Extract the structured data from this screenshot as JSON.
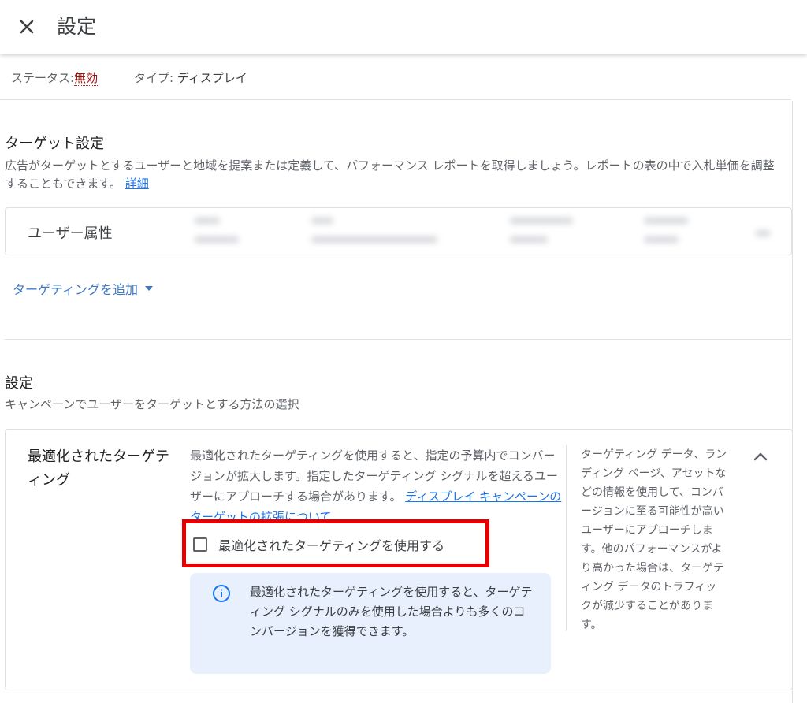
{
  "header": {
    "title": "設定",
    "close_icon": "close-icon"
  },
  "status_bar": {
    "status_label": "ステータス:",
    "status_value": "無効",
    "type_label": "タイプ:",
    "type_value": "ディスプレイ"
  },
  "targeting_section": {
    "title": "ターゲット設定",
    "description": "広告がターゲットとするユーザーと地域を提案または定義して、パフォーマンス レポートを取得しましょう。レポートの表の中で入札単価を調整することもできます。",
    "details_link": "詳細",
    "demographics_label": "ユーザー属性",
    "add_targeting_label": "ターゲティングを追加",
    "dropdown_icon": "caret-down-icon"
  },
  "settings_section": {
    "title": "設定",
    "description": "キャンペーンでユーザーをターゲットとする方法の選択"
  },
  "optimized_targeting": {
    "title": "最適化されたターゲティング",
    "description": "最適化されたターゲティングを使用すると、指定の予算内でコンバージョンが拡大します。指定したターゲティング シグナルを超えるユーザーにアプローチする場合があります。",
    "link": "ディスプレイ キャンペーンのターゲットの拡張について",
    "checkbox_label": "最適化されたターゲティングを使用する",
    "checkbox_checked": false,
    "info_text": "最適化されたターゲティングを使用すると、ターゲティング シグナルのみを使用した場合よりも多くのコンバージョンを獲得できます。",
    "side_text": "ターゲティング データ、ランディング ページ、アセットなどの情報を使用して、コンバージョンに至る可能性が高いユーザーにアプローチします。他のパフォーマンスがより高かった場合は、ターゲティング データのトラフィックが減少することがあります。",
    "info_icon": "info-icon",
    "collapse_icon": "chevron-up-icon"
  },
  "colors": {
    "link": "#1a73e8",
    "status_disabled": "#a50e0e",
    "highlight": "#e60000",
    "info_bg": "#e8f0fe"
  }
}
